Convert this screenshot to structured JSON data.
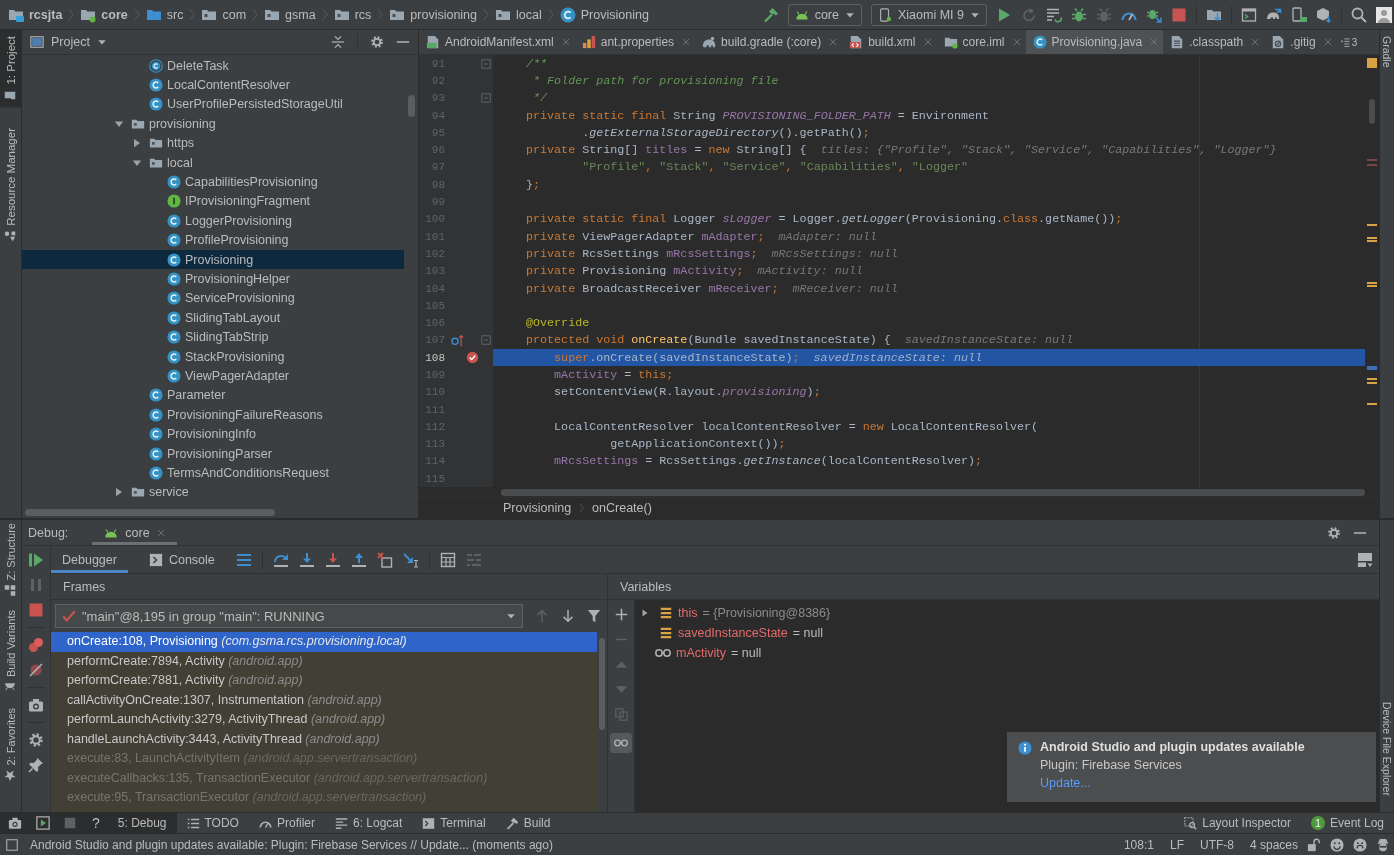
{
  "breadcrumbs": [
    {
      "label": "rcsjta",
      "kind": "module"
    },
    {
      "label": "core",
      "kind": "android_module"
    },
    {
      "label": "src",
      "kind": "source"
    },
    {
      "label": "com",
      "kind": "package"
    },
    {
      "label": "gsma",
      "kind": "package"
    },
    {
      "label": "rcs",
      "kind": "package"
    },
    {
      "label": "provisioning",
      "kind": "package"
    },
    {
      "label": "local",
      "kind": "package"
    },
    {
      "label": "Provisioning",
      "kind": "class"
    }
  ],
  "toolbar": {
    "configuration": "core",
    "device": "Xiaomi MI 9"
  },
  "left_stripe": {
    "top": [
      {
        "label": "1: Project",
        "kind": "project",
        "selected": true
      },
      {
        "label": "Resource Manager",
        "kind": "resources",
        "selected": false
      }
    ],
    "bottom": [
      {
        "label": "Z: Structure",
        "kind": "structure",
        "selected": false
      },
      {
        "label": "Build Variants",
        "kind": "variants",
        "selected": false
      },
      {
        "label": "2: Favorites",
        "kind": "favorites",
        "selected": false
      }
    ]
  },
  "project_panel": {
    "title": "Project",
    "tree": [
      {
        "kind": "offscreen",
        "children": [
          {
            "label": "DeleteTask",
            "kind": "runnable",
            "selected": false
          },
          {
            "label": "LocalContentResolver",
            "kind": "class",
            "selected": false
          },
          {
            "label": "UserProfilePersistedStorageUtil",
            "kind": "class",
            "selected": false
          }
        ]
      },
      {
        "label": "provisioning",
        "kind": "folder",
        "expanded": true,
        "selected": false,
        "children": [
          {
            "label": "https",
            "kind": "folder",
            "expanded": false,
            "selected": false
          },
          {
            "label": "local",
            "kind": "folder",
            "expanded": true,
            "selected": false,
            "children": [
              {
                "label": "CapabilitiesProvisioning",
                "kind": "class",
                "selected": false
              },
              {
                "label": "IProvisioningFragment",
                "kind": "interface",
                "selected": false
              },
              {
                "label": "LoggerProvisioning",
                "kind": "class",
                "selected": false
              },
              {
                "label": "ProfileProvisioning",
                "kind": "class",
                "selected": false
              },
              {
                "label": "Provisioning",
                "kind": "class",
                "selected": true
              },
              {
                "label": "ProvisioningHelper",
                "kind": "class",
                "selected": false
              },
              {
                "label": "ServiceProvisioning",
                "kind": "class",
                "selected": false
              },
              {
                "label": "SlidingTabLayout",
                "kind": "class",
                "selected": false
              },
              {
                "label": "SlidingTabStrip",
                "kind": "class",
                "selected": false
              },
              {
                "label": "StackProvisioning",
                "kind": "class",
                "selected": false
              },
              {
                "label": "ViewPagerAdapter",
                "kind": "class",
                "selected": false
              }
            ]
          },
          {
            "label": "Parameter",
            "kind": "class",
            "selected": false
          },
          {
            "label": "ProvisioningFailureReasons",
            "kind": "class",
            "selected": false
          },
          {
            "label": "ProvisioningInfo",
            "kind": "class",
            "selected": false
          },
          {
            "label": "ProvisioningParser",
            "kind": "class",
            "selected": false
          },
          {
            "label": "TermsAndConditionsRequest",
            "kind": "class",
            "selected": false
          }
        ]
      },
      {
        "label": "service",
        "kind": "folder",
        "expanded": false,
        "selected": false
      }
    ]
  },
  "editor": {
    "tabs": [
      {
        "label": "AndroidManifest.xml",
        "kind": "manifest",
        "selected": false
      },
      {
        "label": "ant.properties",
        "kind": "properties",
        "selected": false
      },
      {
        "label": "build.gradle (:core)",
        "kind": "gradle",
        "selected": false
      },
      {
        "label": "build.xml",
        "kind": "ant",
        "selected": false
      },
      {
        "label": "core.iml",
        "kind": "module",
        "selected": false
      },
      {
        "label": "Provisioning.java",
        "kind": "class",
        "selected": true
      },
      {
        "label": ".classpath",
        "kind": "text",
        "selected": false
      },
      {
        "label": ".gitig",
        "kind": "ignore",
        "selected": false
      }
    ],
    "tabs_overflow": "3",
    "lines": [
      {
        "number": "91",
        "current": false,
        "gutter": [
          {
            "kind": "fold"
          }
        ],
        "segments": [
          {
            "kind": "comment",
            "text": "    /**"
          }
        ]
      },
      {
        "number": "92",
        "current": false,
        "segments": [
          {
            "kind": "comment",
            "text": "     * Folder path for provisioning file"
          }
        ]
      },
      {
        "number": "93",
        "current": false,
        "gutter": [
          {
            "kind": "fold"
          }
        ],
        "segments": [
          {
            "kind": "comment",
            "text": "     */"
          }
        ]
      },
      {
        "number": "94",
        "current": false,
        "segments": [
          {
            "kind": "keyword",
            "text": "    private static final "
          },
          {
            "kind": "plain",
            "text": "String "
          },
          {
            "kind": "constant",
            "text": "PROVISIONING_FOLDER_PATH"
          },
          {
            "kind": "plain",
            "text": " = Environment"
          }
        ]
      },
      {
        "number": "95",
        "current": false,
        "segments": [
          {
            "kind": "plain",
            "text": "            ."
          },
          {
            "kind": "static",
            "text": "getExternalStorageDirectory"
          },
          {
            "kind": "plain",
            "text": "().getPath()"
          },
          {
            "kind": "keyword",
            "text": ";"
          }
        ]
      },
      {
        "number": "96",
        "current": false,
        "segments": [
          {
            "kind": "keyword",
            "text": "    private "
          },
          {
            "kind": "plain",
            "text": "String[] "
          },
          {
            "kind": "field",
            "text": "titles"
          },
          {
            "kind": "plain",
            "text": " = "
          },
          {
            "kind": "keyword",
            "text": "new "
          },
          {
            "kind": "plain",
            "text": "String[] {"
          }
        ],
        "hint": "titles: {\"Profile\", \"Stack\", \"Service\", \"Capabilities\", \"Logger\"}"
      },
      {
        "number": "97",
        "current": false,
        "segments": [
          {
            "kind": "string",
            "text": "            \"Profile\""
          },
          {
            "kind": "keyword",
            "text": ", "
          },
          {
            "kind": "string",
            "text": "\"Stack\""
          },
          {
            "kind": "keyword",
            "text": ", "
          },
          {
            "kind": "string",
            "text": "\"Service\""
          },
          {
            "kind": "keyword",
            "text": ", "
          },
          {
            "kind": "string",
            "text": "\"Capabilities\""
          },
          {
            "kind": "keyword",
            "text": ", "
          },
          {
            "kind": "string",
            "text": "\"Logger\""
          }
        ]
      },
      {
        "number": "98",
        "current": false,
        "segments": [
          {
            "kind": "plain",
            "text": "    }"
          },
          {
            "kind": "keyword",
            "text": ";"
          }
        ]
      },
      {
        "number": "99",
        "current": false
      },
      {
        "number": "100",
        "current": false,
        "segments": [
          {
            "kind": "keyword",
            "text": "    private static final "
          },
          {
            "kind": "plain",
            "text": "Logger "
          },
          {
            "kind": "constant",
            "text": "sLogger"
          },
          {
            "kind": "plain",
            "text": " = Logger."
          },
          {
            "kind": "static",
            "text": "getLogger"
          },
          {
            "kind": "plain",
            "text": "(Provisioning."
          },
          {
            "kind": "keyword",
            "text": "class"
          },
          {
            "kind": "plain",
            "text": ".getName())"
          },
          {
            "kind": "keyword",
            "text": ";"
          }
        ]
      },
      {
        "number": "101",
        "current": false,
        "segments": [
          {
            "kind": "keyword",
            "text": "    private "
          },
          {
            "kind": "plain",
            "text": "ViewPagerAdapter "
          },
          {
            "kind": "field",
            "text": "mAdapter"
          },
          {
            "kind": "keyword",
            "text": ";"
          }
        ],
        "hint": "mAdapter: null"
      },
      {
        "number": "102",
        "current": false,
        "segments": [
          {
            "kind": "keyword",
            "text": "    private "
          },
          {
            "kind": "plain",
            "text": "RcsSettings "
          },
          {
            "kind": "field",
            "text": "mRcsSettings"
          },
          {
            "kind": "keyword",
            "text": ";"
          }
        ],
        "hint": "mRcsSettings: null"
      },
      {
        "number": "103",
        "current": false,
        "segments": [
          {
            "kind": "keyword",
            "text": "    private "
          },
          {
            "kind": "plain",
            "text": "Provisioning "
          },
          {
            "kind": "field",
            "text": "mActivity"
          },
          {
            "kind": "keyword",
            "text": ";"
          }
        ],
        "hint": "mActivity: null"
      },
      {
        "number": "104",
        "current": false,
        "segments": [
          {
            "kind": "keyword",
            "text": "    private "
          },
          {
            "kind": "plain",
            "text": "BroadcastReceiver "
          },
          {
            "kind": "field",
            "text": "mReceiver"
          },
          {
            "kind": "keyword",
            "text": ";"
          }
        ],
        "hint": "mReceiver: null"
      },
      {
        "number": "105",
        "current": false
      },
      {
        "number": "106",
        "current": false,
        "segments": [
          {
            "kind": "annotation",
            "text": "    @Override"
          }
        ]
      },
      {
        "number": "107",
        "current": false,
        "gutter": [
          {
            "kind": "override"
          },
          {
            "kind": "fold"
          }
        ],
        "segments": [
          {
            "kind": "keyword",
            "text": "    protected void "
          },
          {
            "kind": "method",
            "text": "onCreate"
          },
          {
            "kind": "plain",
            "text": "(Bundle savedInstanceState) {"
          }
        ],
        "hint": "savedInstanceState: null"
      },
      {
        "number": "108",
        "current": true,
        "gutter": [
          {
            "kind": "breakpoint"
          }
        ],
        "segments": [
          {
            "kind": "keyword",
            "text": "        super"
          },
          {
            "kind": "plain",
            "text": ".onCreate(savedInstanceState)"
          },
          {
            "kind": "keyword",
            "text": ";"
          }
        ],
        "hint": "savedInstanceState: null"
      },
      {
        "number": "109",
        "current": false,
        "segments": [
          {
            "kind": "field",
            "text": "        mActivity"
          },
          {
            "kind": "plain",
            "text": " = "
          },
          {
            "kind": "keyword",
            "text": "this;"
          }
        ]
      },
      {
        "number": "110",
        "current": false,
        "segments": [
          {
            "kind": "plain",
            "text": "        setContentView(R.layout."
          },
          {
            "kind": "constant",
            "text": "provisioning"
          },
          {
            "kind": "plain",
            "text": ")"
          },
          {
            "kind": "keyword",
            "text": ";"
          }
        ]
      },
      {
        "number": "111",
        "current": false
      },
      {
        "number": "112",
        "current": false,
        "segments": [
          {
            "kind": "plain",
            "text": "        LocalContentResolver localContentResolver = "
          },
          {
            "kind": "keyword",
            "text": "new "
          },
          {
            "kind": "plain",
            "text": "LocalContentResolver("
          }
        ]
      },
      {
        "number": "113",
        "current": false,
        "segments": [
          {
            "kind": "plain",
            "text": "                getApplicationContext())"
          },
          {
            "kind": "keyword",
            "text": ";"
          }
        ]
      },
      {
        "number": "114",
        "current": false,
        "segments": [
          {
            "kind": "field",
            "text": "        mRcsSettings"
          },
          {
            "kind": "plain",
            "text": " = RcsSettings."
          },
          {
            "kind": "static",
            "text": "getInstance"
          },
          {
            "kind": "plain",
            "text": "(localContentResolver)"
          },
          {
            "kind": "keyword",
            "text": ";"
          }
        ]
      },
      {
        "number": "115",
        "current": false
      }
    ],
    "breadcrumbs": [
      "Provisioning",
      "onCreate()"
    ]
  },
  "right_stripe": {
    "top": [
      "Gradle"
    ],
    "bottom": [
      "Device File Explorer"
    ]
  },
  "debug": {
    "title": "Debug:",
    "session": "core",
    "tabs": [
      {
        "label": "Debugger",
        "kind": "debugger",
        "selected": true
      },
      {
        "label": "Console",
        "kind": "console",
        "selected": false
      }
    ],
    "frames_title": "Frames",
    "thread": "\"main\"@8,195 in group \"main\": RUNNING",
    "frames": [
      {
        "text": "onCreate:108, Provisioning *(com.gsma.rcs.provisioning.local)*",
        "selected": true,
        "dimmed": false
      },
      {
        "text": "performCreate:7894, Activity *(android.app)*",
        "selected": false,
        "dimmed": false
      },
      {
        "text": "performCreate:7881, Activity *(android.app)*",
        "selected": false,
        "dimmed": false
      },
      {
        "text": "callActivityOnCreate:1307, Instrumentation *(android.app)*",
        "selected": false,
        "dimmed": false
      },
      {
        "text": "performLaunchActivity:3279, ActivityThread *(android.app)*",
        "selected": false,
        "dimmed": false
      },
      {
        "text": "handleLaunchActivity:3443, ActivityThread *(android.app)*",
        "selected": false,
        "dimmed": false
      },
      {
        "text": "execute:83, LaunchActivityItem *(android.app.servertransaction)*",
        "selected": false,
        "dimmed": true
      },
      {
        "text": "executeCallbacks:135, TransactionExecutor *(android.app.servertransaction)*",
        "selected": false,
        "dimmed": true
      },
      {
        "text": "execute:95, TransactionExecutor *(android.app.servertransaction)*",
        "selected": false,
        "dimmed": true
      }
    ],
    "variables_title": "Variables",
    "watch_toggle_on": true,
    "variables": [
      {
        "name": "this",
        "value": "= {Provisioning@8386}",
        "kind": "object"
      },
      {
        "name": "savedInstanceState",
        "value": "= null",
        "kind": "field"
      },
      {
        "name": "mActivity",
        "value": "= null",
        "kind": "watch"
      }
    ]
  },
  "notification": {
    "title": "Android Studio and plugin updates available",
    "body": "Plugin: Firebase Services",
    "link": "Update..."
  },
  "bottom_bar": {
    "help": "?",
    "tabs": [
      {
        "label": "5: Debug",
        "kind": "debug",
        "selected": true
      },
      {
        "label": "TODO",
        "kind": "todo",
        "selected": false
      },
      {
        "label": "Profiler",
        "kind": "profiler",
        "selected": false
      },
      {
        "label": "6: Logcat",
        "kind": "logcat",
        "selected": false
      },
      {
        "label": "Terminal",
        "kind": "terminal",
        "selected": false
      },
      {
        "label": "Build",
        "kind": "build",
        "selected": false
      }
    ],
    "right_tabs": [
      {
        "label": "Layout Inspector",
        "kind": "inspector"
      },
      {
        "label": "Event Log",
        "kind": "log",
        "badge": "1"
      }
    ]
  },
  "status_bar": {
    "message": "Android Studio and plugin updates available: Plugin: Firebase Services // Update... (moments ago)",
    "position": "108:1",
    "line_separator": "LF",
    "encoding": "UTF-8",
    "indent": "4 spaces"
  }
}
